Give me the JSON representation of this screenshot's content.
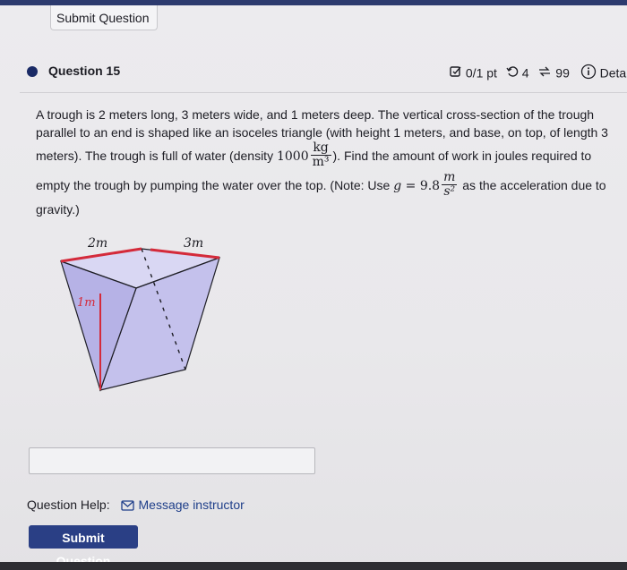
{
  "top": {
    "submit_label": "Submit Question"
  },
  "question": {
    "number_label": "Question 15",
    "score": "0/1 pt",
    "retries": "4",
    "attempts": "99",
    "details_label": "Detai",
    "text_line1": "A trough is 2 meters long, 3 meters wide, and 1 meters deep. The vertical cross-section of the trough",
    "text_line2": "parallel to an end is shaped like an isoceles triangle (with height 1 meters, and base, on top, of length 3",
    "text_line3_a": "meters). The trough is full of water (density ",
    "density_value": "1000",
    "density_num": "kg",
    "density_den": "m³",
    "text_line3_b": "). Find the amount of work in joules required to",
    "text_line4_a": "empty the trough by pumping the water over the top. (Note: Use ",
    "g_symbol": "g",
    "g_eq": " = 9.8",
    "g_num": "m",
    "g_den": "s²",
    "text_line4_b": " as the acceleration due to",
    "text_line5": "gravity.)"
  },
  "figure": {
    "label_length": "2m",
    "label_width": "3m",
    "label_depth": "1m"
  },
  "answer": {
    "value": "",
    "placeholder": ""
  },
  "help": {
    "label": "Question Help:",
    "message_link": "Message instructor"
  },
  "bottom": {
    "submit_label": "Submit Question"
  },
  "colors": {
    "brand": "#2a3f85",
    "dot": "#1a2a66",
    "figure_fill": "#c9c7ee",
    "figure_edge": "#d42a3a"
  },
  "icons": {
    "score": "checkbox-edit-icon",
    "retries": "retry-icon",
    "attempts": "attempts-icon",
    "details": "info-icon",
    "message": "mail-icon"
  }
}
